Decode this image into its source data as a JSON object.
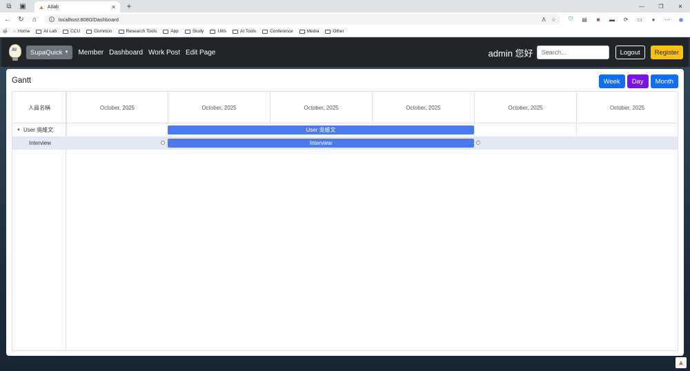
{
  "browser": {
    "tab_title": "AIlab",
    "url": "localhost:8080/Dashboard",
    "bookmarks": [
      "Home",
      "AI Lab",
      "CCU",
      "Common",
      "Research Tools",
      "App",
      "Study",
      "Utils",
      "AI Tools",
      "Conference",
      "Media",
      "Other"
    ]
  },
  "navbar": {
    "logo_text": "AI",
    "brand": "SupaQuick",
    "links": [
      "Member",
      "Dashboard",
      "Work Post",
      "Edit Page"
    ],
    "greeting": "admin 您好",
    "search_placeholder": "Search...",
    "logout": "Logout",
    "register": "Register"
  },
  "gantt": {
    "title": "Gantt",
    "views": [
      "Week",
      "Day",
      "Month"
    ],
    "name_header": "人員名稱",
    "scale_labels": [
      "October, 2025",
      "October, 2025",
      "October, 2025",
      "October, 2025",
      "October, 2025",
      "October, 2025"
    ],
    "rows": [
      {
        "label": "User 吳維文",
        "bar_text": "User 吳維文",
        "expanded": true
      },
      {
        "label": "Interview",
        "bar_text": "Interview",
        "selected": true
      }
    ]
  },
  "colors": {
    "accent": "#0d6efd",
    "day_button": "#7a12f0",
    "register": "#ffc107",
    "bar": "#4d79f0",
    "navbar": "#212529"
  }
}
